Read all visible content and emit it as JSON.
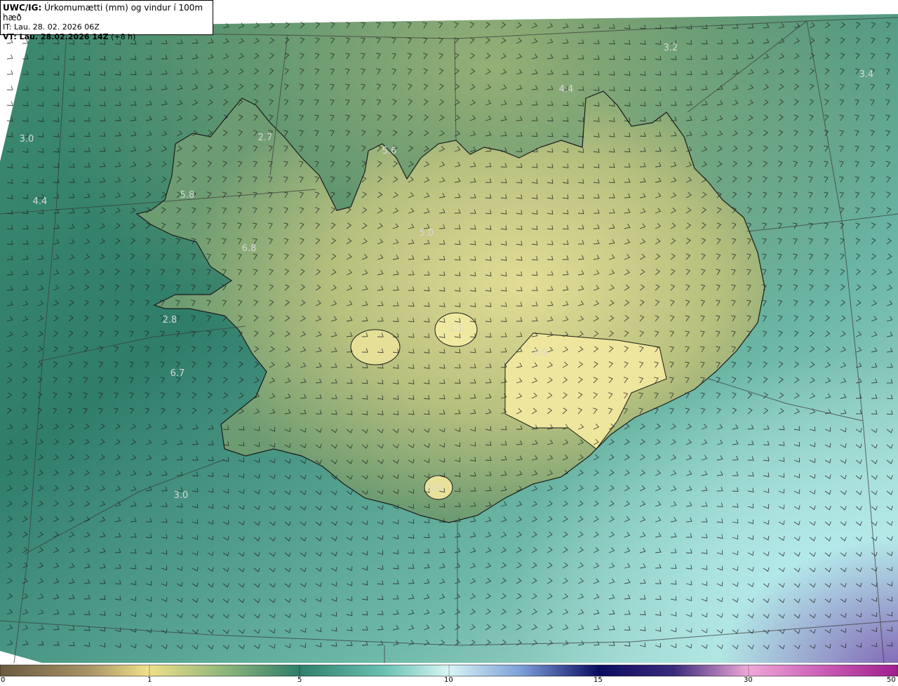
{
  "header": {
    "product": "UWC/IG:",
    "description": " Úrkomumætti (mm) og vindur í 100m hæð",
    "issue_time": "IT: Lau. 28. 02. 2026 06Z",
    "valid_label": "VT: Lau. 28.02.2026 14Z",
    "valid_offset": " (+8 h)"
  },
  "colorbar": {
    "ticks": [
      "0",
      "1",
      "5",
      "10",
      "15",
      "30",
      "50"
    ],
    "colors": [
      "#6b5a3f",
      "#f0e08a",
      "#2f7e6a",
      "#d9f5f5",
      "#0b0c60",
      "#f0a8d8",
      "#a01e8e"
    ]
  },
  "map_labels": [
    {
      "text": "3.2"
    },
    {
      "text": "3.4"
    },
    {
      "text": "4.4"
    },
    {
      "text": "3.0"
    },
    {
      "text": "2.7"
    },
    {
      "text": "5.6"
    },
    {
      "text": "4.4"
    },
    {
      "text": "5.8"
    },
    {
      "text": "6.8"
    },
    {
      "text": "5.0"
    },
    {
      "text": "2.8"
    },
    {
      "text": "6.7"
    },
    {
      "text": "1.1"
    },
    {
      "text": "3.0"
    },
    {
      "text": "1.9"
    },
    {
      "text": "3.0"
    }
  ],
  "colors": {
    "sea_deep": "#2f7e6a",
    "sea_light": "#a8e0dc",
    "land_low": "#7a9e6a",
    "land_high": "#e8e39a",
    "coast": "#1b1b1b"
  }
}
